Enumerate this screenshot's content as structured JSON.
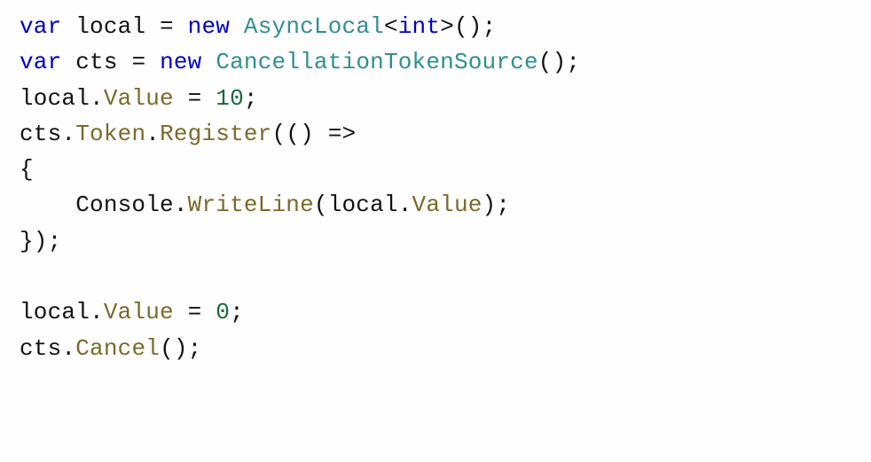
{
  "code": {
    "l1": {
      "kw_var": "var",
      "sp": " ",
      "local": "local",
      "eq": " = ",
      "kw_new": "new",
      "sp2": " ",
      "type": "AsyncLocal",
      "lt": "<",
      "int": "int",
      "gt": ">",
      "parens": "();"
    },
    "l2": {
      "kw_var": "var",
      "sp": " ",
      "cts": "cts",
      "eq": " = ",
      "kw_new": "new",
      "sp2": " ",
      "type": "CancellationTokenSource",
      "parens": "();"
    },
    "l3": {
      "local": "local",
      "dot": ".",
      "value": "Value",
      "eq": " = ",
      "num": "10",
      "semi": ";"
    },
    "l4": {
      "cts": "cts",
      "dot1": ".",
      "token": "Token",
      "dot2": ".",
      "register": "Register",
      "lp": "(()",
      "arrow": " =>"
    },
    "l5": {
      "brace": "{"
    },
    "l6": {
      "indent": "    ",
      "console": "Console",
      "dot": ".",
      "wl": "WriteLine",
      "lp": "(",
      "local": "local",
      "dot2": ".",
      "value": "Value",
      "rp": ");"
    },
    "l7": {
      "brace": "});"
    },
    "l8": {
      "blank": ""
    },
    "l9": {
      "local": "local",
      "dot": ".",
      "value": "Value",
      "eq": " = ",
      "num": "0",
      "semi": ";"
    },
    "l10": {
      "cts": "cts",
      "dot": ".",
      "cancel": "Cancel",
      "parens": "();"
    }
  }
}
